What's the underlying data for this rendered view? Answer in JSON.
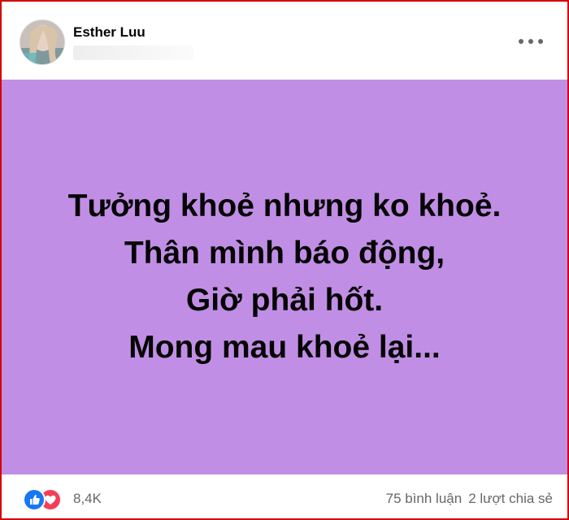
{
  "post": {
    "author": {
      "name": "Esther Luu"
    },
    "menu_icon": "more-horizontal-icon",
    "status": {
      "background": "#c18ee5",
      "lines": [
        "Tưởng khoẻ nhưng ko khoẻ.",
        "Thân mình báo động,",
        "Giờ phải hốt.",
        "Mong mau khoẻ lại..."
      ]
    },
    "footer": {
      "reaction_icons": [
        "like-icon",
        "love-icon"
      ],
      "reaction_count": "8,4K",
      "comments": "75 bình luận",
      "shares": "2 lượt chia sẻ"
    }
  },
  "colors": {
    "like": "#1877f2",
    "love": "#f33e58",
    "border": "#d40000",
    "text_secondary": "#65676b"
  }
}
